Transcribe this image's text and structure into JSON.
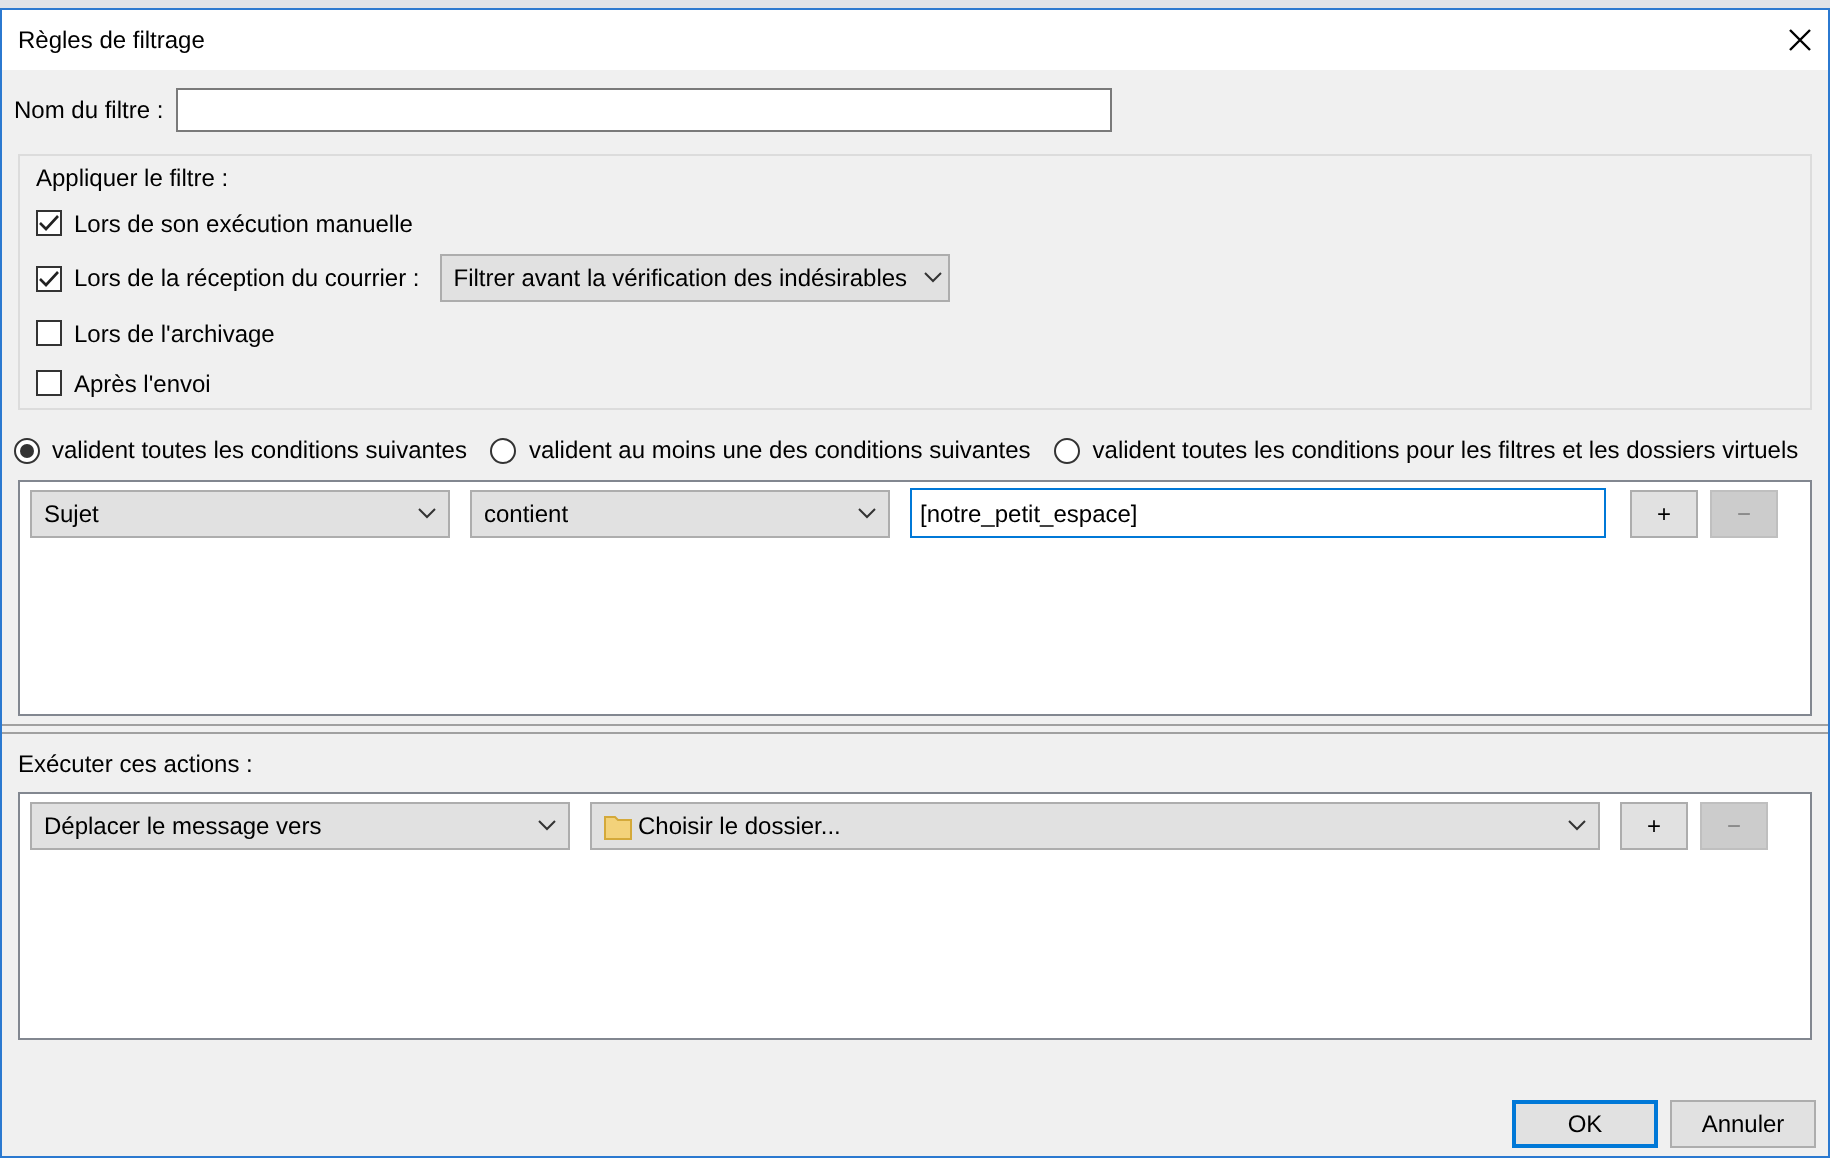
{
  "window": {
    "title": "Règles de filtrage"
  },
  "filter_name": {
    "label": "Nom du filtre :"
  },
  "apply": {
    "title": "Appliquer le filtre :",
    "options": [
      {
        "label": "Lors de son exécution manuelle",
        "checked": true
      },
      {
        "label": "Lors de la réception du courrier :",
        "checked": true,
        "dropdown": "Filtrer avant la vérification des indésirables"
      },
      {
        "label": "Lors de l'archivage",
        "checked": false
      },
      {
        "label": "Après l'envoi",
        "checked": false
      }
    ]
  },
  "match": [
    {
      "label": "valident toutes les conditions suivantes",
      "selected": true
    },
    {
      "label": "valident au moins une des conditions suivantes",
      "selected": false
    },
    {
      "label": "valident toutes les conditions pour les filtres et les dossiers virtuels",
      "selected": false
    }
  ],
  "conditions": [
    {
      "field": "Sujet",
      "operator": "contient",
      "value": "[notre_petit_espace]",
      "add": {
        "label": "+",
        "disabled": false
      },
      "remove": {
        "label": "−",
        "disabled": true
      }
    }
  ],
  "actions_title": "Exécuter ces actions :",
  "actions": [
    {
      "action": "Déplacer le message vers",
      "target": "Choisir le dossier...",
      "add": {
        "label": "+",
        "disabled": false
      },
      "remove": {
        "label": "−",
        "disabled": true
      }
    }
  ],
  "buttons": [
    {
      "label": "OK",
      "default": true
    },
    {
      "label": "Annuler",
      "default": false
    }
  ]
}
